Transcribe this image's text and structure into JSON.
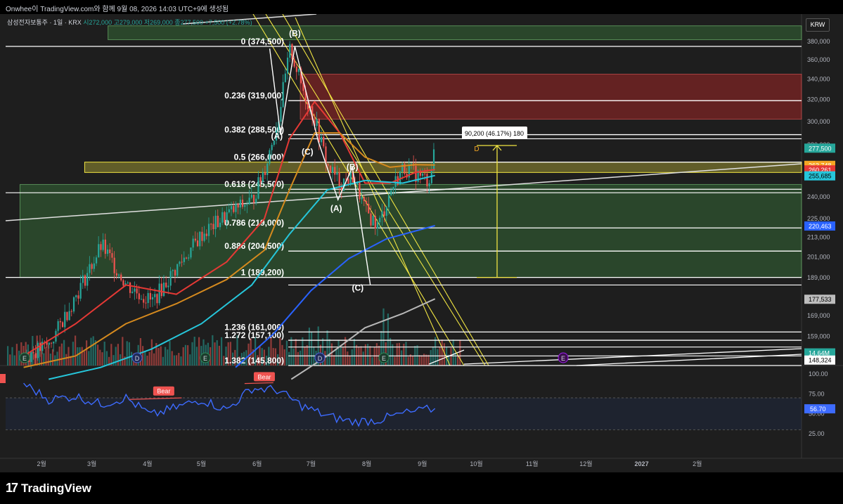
{
  "header": {
    "title": "Onwhee이 TradingView.com와 함께 9월 08, 2026 14:03 UTC+9에 생성됨"
  },
  "symbol": {
    "name": "삼성전자보통주 · 1일 · KRX",
    "ohlc_text": "시272,000 고279,000 저269,000 종277,500 +7,500 (+2.78%)",
    "currency": "KRW"
  },
  "brand": {
    "logo_mark": "17",
    "name": "TradingView"
  },
  "colors": {
    "up": "#26a69a",
    "down": "#ef5350",
    "fib_line": "#ffffff",
    "channel": "#f0e442",
    "ma_red": "#e53935",
    "ma_orange": "#d58a1e",
    "ma_teal": "#26c6da",
    "ma_blue": "#2962ff",
    "ma_gray": "#b8b8b8",
    "rsi": "#3d6bff"
  },
  "chart_data": {
    "type": "line",
    "x_axis": {
      "labels": [
        "2월",
        "3월",
        "4월",
        "5월",
        "6월",
        "7월",
        "8월",
        "9월",
        "10월",
        "11월",
        "12월",
        "2027",
        "2월"
      ]
    },
    "price_axis": {
      "labels": [
        "380,000",
        "360,000",
        "340,000",
        "320,000",
        "300,000",
        "280,000",
        "240,000",
        "225,000",
        "213,000",
        "201,000",
        "189,000",
        "169,000",
        "159,000",
        "151,000"
      ],
      "scale": "log",
      "range": [
        140000,
        400000
      ]
    },
    "price_badges": [
      {
        "label": "277,500",
        "value": 277500,
        "color": "#26a69a"
      },
      {
        "label": "263,748",
        "value": 263748,
        "color": "#f5a623"
      },
      {
        "label": "260,261",
        "value": 260261,
        "color": "#e53935"
      },
      {
        "label": "255,685",
        "value": 255685,
        "color": "#26c6da"
      },
      {
        "label": "220,463",
        "value": 220463,
        "color": "#2962ff"
      },
      {
        "label": "177,533",
        "value": 177533,
        "color": "#bdbdbd"
      },
      {
        "label": "14.64M",
        "value": 151500,
        "color": "#26a69a"
      },
      {
        "label": "148,324",
        "value": 148324,
        "color": "#ffffff"
      }
    ],
    "fib_levels": [
      {
        "ratio": "0",
        "value": 374500,
        "label": "0 (374,500)"
      },
      {
        "ratio": "0.236",
        "value": 319000,
        "label": "0.236 (319,000)"
      },
      {
        "ratio": "0.382",
        "value": 288500,
        "label": "0.382 (288,500)"
      },
      {
        "ratio": "0.5",
        "value": 266000,
        "label": "0.5 (266,000)"
      },
      {
        "ratio": "0.618",
        "value": 245500,
        "label": "0.618 (245,500)"
      },
      {
        "ratio": "0.786",
        "value": 219000,
        "label": "0.786 (219,000)"
      },
      {
        "ratio": "0.886",
        "value": 204500,
        "label": "0.886 (204,500)"
      },
      {
        "ratio": "1",
        "value": 189200,
        "label": "1 (189,200)"
      },
      {
        "ratio": "1.236",
        "value": 161000,
        "label": "1.236 (161,000)"
      },
      {
        "ratio": "1.272",
        "value": 157100,
        "label": "1.272 (157,100)"
      },
      {
        "ratio": "1.382",
        "value": 145800,
        "label": "1.382 (145,800)"
      }
    ],
    "extra_lines": [
      {
        "value": 285000
      },
      {
        "value": 243000
      },
      {
        "value": 185000
      },
      {
        "value": 154000
      },
      {
        "value": 150000
      }
    ],
    "wave_labels": [
      {
        "text": "(B)",
        "x": "2026-06-22",
        "y": 386000
      },
      {
        "text": "(A)",
        "x": "2026-06-12",
        "y": 285000
      },
      {
        "text": "(C)",
        "x": "2026-06-29",
        "y": 272000
      },
      {
        "text": "(B)",
        "x": "2026-07-24",
        "y": 260000
      },
      {
        "text": "(A)",
        "x": "2026-07-15",
        "y": 230000
      },
      {
        "text": "(C)",
        "x": "2026-07-27",
        "y": 182000
      }
    ],
    "measure": {
      "label": "90,200 (46.17%) 180",
      "from": 189200,
      "to": 279400
    },
    "zones": [
      {
        "kind": "green",
        "from_x": "2026-03-10",
        "to_x": "2027-03-31",
        "low": 382000,
        "high": 398000
      },
      {
        "kind": "red",
        "from_x": "2026-06-25",
        "to_x": "2027-03-31",
        "low": 302000,
        "high": 345000
      },
      {
        "kind": "yellow",
        "from_x": "2026-02-25",
        "to_x": "2027-03-31",
        "low": 258000,
        "high": 266000
      },
      {
        "kind": "green",
        "from_x": "2026-01-20",
        "to_x": "2027-03-31",
        "low": 189200,
        "high": 249000
      }
    ],
    "series": [
      {
        "name": "close",
        "x": [
          "2026-01-22",
          "2026-02-05",
          "2026-02-20",
          "2026-03-06",
          "2026-03-20",
          "2026-04-03",
          "2026-04-17",
          "2026-05-01",
          "2026-05-15",
          "2026-05-29",
          "2026-06-05",
          "2026-06-12",
          "2026-06-19",
          "2026-06-26",
          "2026-07-03",
          "2026-07-10",
          "2026-07-17",
          "2026-07-24",
          "2026-07-31",
          "2026-08-07",
          "2026-08-14",
          "2026-08-21",
          "2026-08-28",
          "2026-09-04",
          "2026-09-08"
        ],
        "values": [
          150000,
          155000,
          180000,
          208000,
          185000,
          176000,
          195000,
          215000,
          228000,
          238000,
          262000,
          300000,
          372000,
          330000,
          300000,
          262000,
          250000,
          255000,
          230000,
          220000,
          245000,
          262000,
          257000,
          252000,
          277500
        ]
      },
      {
        "name": "ma_red",
        "x": [
          "2026-01-22",
          "2026-02-20",
          "2026-03-20",
          "2026-04-17",
          "2026-05-15",
          "2026-06-05",
          "2026-06-19",
          "2026-07-03",
          "2026-07-17",
          "2026-07-31",
          "2026-08-14",
          "2026-08-28",
          "2026-09-08"
        ],
        "values": [
          150000,
          165000,
          185000,
          180000,
          198000,
          225000,
          285000,
          318000,
          290000,
          250000,
          250000,
          258000,
          260261
        ]
      },
      {
        "name": "ma_orange",
        "x": [
          "2026-01-22",
          "2026-02-20",
          "2026-03-20",
          "2026-04-17",
          "2026-05-15",
          "2026-06-05",
          "2026-06-19",
          "2026-07-03",
          "2026-07-17",
          "2026-07-31",
          "2026-08-14",
          "2026-08-28",
          "2026-09-08"
        ],
        "values": [
          145000,
          150000,
          165000,
          175000,
          188000,
          205000,
          245000,
          290000,
          290000,
          270000,
          262000,
          264000,
          263748
        ]
      },
      {
        "name": "ma_teal",
        "x": [
          "2026-02-05",
          "2026-03-06",
          "2026-04-03",
          "2026-05-01",
          "2026-05-29",
          "2026-06-19",
          "2026-07-10",
          "2026-07-31",
          "2026-08-21",
          "2026-09-08"
        ],
        "values": [
          140000,
          145000,
          153000,
          165000,
          185000,
          215000,
          245000,
          252000,
          250000,
          255685
        ]
      },
      {
        "name": "ma_blue",
        "x": [
          "2026-05-20",
          "2026-06-10",
          "2026-07-01",
          "2026-07-22",
          "2026-08-12",
          "2026-09-08"
        ],
        "values": [
          145000,
          160000,
          182000,
          200000,
          212000,
          220463
        ]
      },
      {
        "name": "ma_gray",
        "x": [
          "2026-06-20",
          "2026-07-10",
          "2026-07-31",
          "2026-08-21",
          "2026-09-08"
        ],
        "values": [
          140000,
          150000,
          163000,
          170000,
          177533
        ]
      }
    ],
    "rsi": {
      "axis_labels": [
        "100.00",
        "75.00",
        "50.00",
        "25.00"
      ],
      "range": [
        0,
        110
      ],
      "value_label": "56.70",
      "bear_labels": [
        {
          "text": "Bear",
          "x": "2026-04-10",
          "y": 72
        },
        {
          "text": "Bear",
          "x": "2026-06-05",
          "y": 90
        }
      ],
      "x": [
        "2026-01-22",
        "2026-02-05",
        "2026-02-20",
        "2026-03-06",
        "2026-03-20",
        "2026-04-03",
        "2026-04-17",
        "2026-05-01",
        "2026-05-15",
        "2026-05-29",
        "2026-06-12",
        "2026-06-26",
        "2026-07-10",
        "2026-07-24",
        "2026-08-07",
        "2026-08-21",
        "2026-09-08"
      ],
      "values": [
        88,
        68,
        72,
        62,
        70,
        48,
        58,
        68,
        55,
        82,
        80,
        60,
        47,
        40,
        42,
        50,
        56.7
      ]
    },
    "grid": false,
    "legend": "none"
  }
}
